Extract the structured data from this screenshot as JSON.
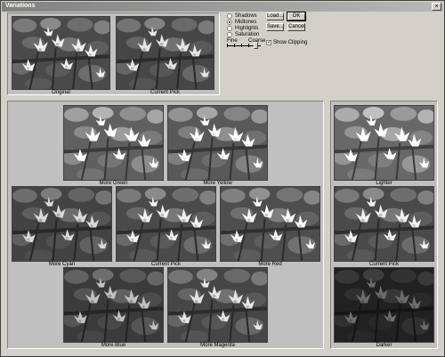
{
  "window": {
    "title": "Variations",
    "close_glyph": "×"
  },
  "top": {
    "original_label": "Original",
    "current_label": "Current Pick"
  },
  "options": {
    "radios": [
      {
        "label": "Shadows",
        "checked": false
      },
      {
        "label": "Midtones",
        "checked": true
      },
      {
        "label": "Highlights",
        "checked": false
      },
      {
        "label": "Saturation",
        "checked": false
      }
    ],
    "fine_label": "Fine",
    "coarse_label": "Coarse",
    "show_clipping_label": "Show Clipping",
    "show_clipping_checked": true
  },
  "buttons": {
    "load": "Load...",
    "save": "Save...",
    "ok": "OK",
    "cancel": "Cancel"
  },
  "color_grid": {
    "more_green": "More Green",
    "more_yellow": "More Yellow",
    "more_cyan": "More Cyan",
    "current_pick": "Current Pick",
    "more_red": "More Red",
    "more_blue": "More Blue",
    "more_magenta": "More Magenta"
  },
  "lightness": {
    "lighter": "Lighter",
    "current_pick": "Current Pick",
    "darker": "Darker"
  }
}
